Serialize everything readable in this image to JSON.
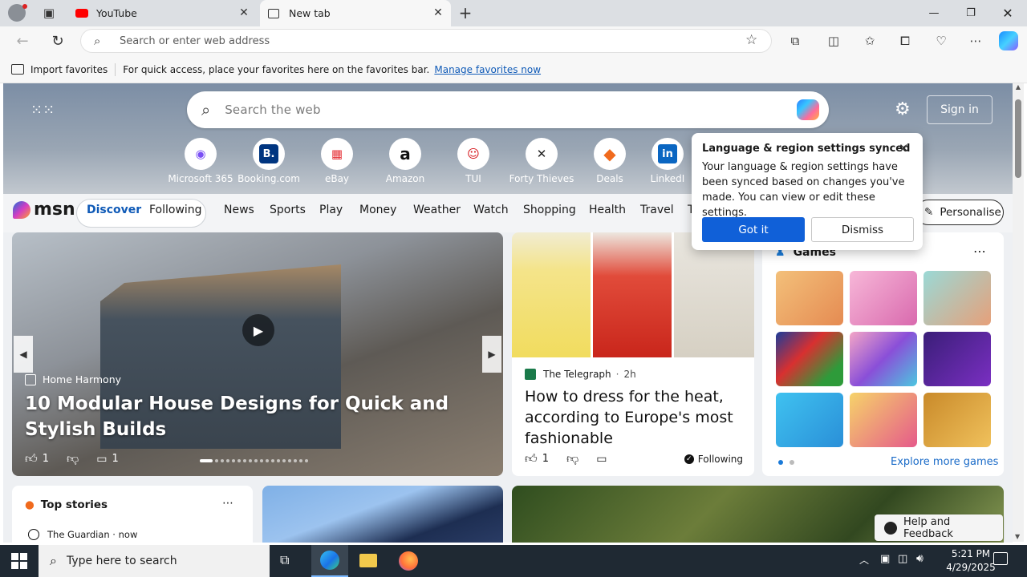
{
  "tabs": [
    {
      "label": "YouTube",
      "icon": "youtube-icon",
      "active": false
    },
    {
      "label": "New tab",
      "icon": "newtab-icon",
      "active": true
    }
  ],
  "omnibox": {
    "placeholder": "Search or enter web address"
  },
  "favbar": {
    "import_label": "Import favorites",
    "message": "For quick access, place your favorites here on the favorites bar.",
    "manage_link": "Manage favorites now"
  },
  "hero": {
    "search_placeholder": "Search the web",
    "signin_label": "Sign in",
    "quicklinks": [
      "Microsoft 365",
      "Booking.com",
      "eBay",
      "Amazon",
      "TUI",
      "Forty Thieves",
      "Deals",
      "LinkedI"
    ]
  },
  "popup": {
    "title": "Language & region settings synced",
    "body": "Your language & region settings have been synced based on changes you've made. You can view or edit these settings.",
    "got_it": "Got it",
    "dismiss": "Dismiss"
  },
  "nav": {
    "brand": "msn",
    "discover": "Discover",
    "following": "Following",
    "items": [
      "News",
      "Sports",
      "Play",
      "Money",
      "Weather",
      "Watch",
      "Shopping",
      "Health",
      "Travel",
      "T"
    ],
    "personalise": "Personalise"
  },
  "main_card": {
    "source": "Home Harmony",
    "title": "10 Modular House Designs for Quick and Stylish Builds",
    "likes": "1",
    "comments": "1"
  },
  "fashion_card": {
    "source": "The Telegraph",
    "time": "2h",
    "title": "How to dress for the heat, according to Europe's most fashionable",
    "likes": "1",
    "following": "Following"
  },
  "games_card": {
    "title": "Games",
    "explore": "Explore more games"
  },
  "top_stories": {
    "title": "Top stories",
    "source": "The Guardian · now"
  },
  "help": {
    "label": "Help and Feedback"
  },
  "taskbar": {
    "search_placeholder": "Type here to search",
    "time": "5:21 PM",
    "date": "4/29/2025"
  }
}
